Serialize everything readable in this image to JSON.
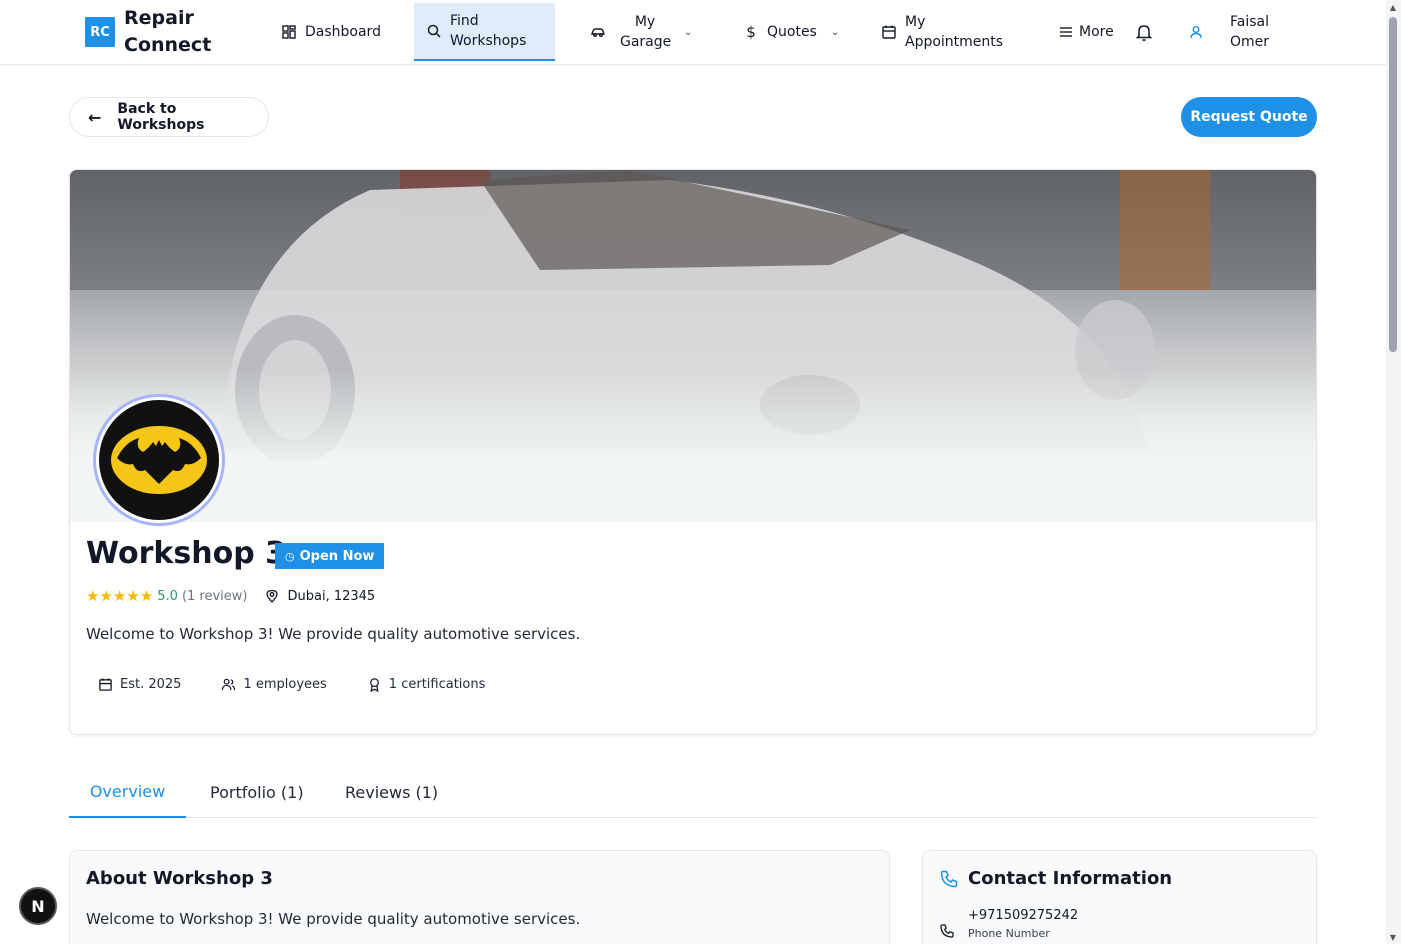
{
  "nav": {
    "logo_abbr": "RC",
    "logo_text": "Repair Connect",
    "items": [
      {
        "label": "Dashboard",
        "icon": "grid-icon"
      },
      {
        "label": "Find Workshops",
        "icon": "search-icon"
      },
      {
        "label": "My Garage",
        "icon": "car-icon"
      },
      {
        "label": "Quotes",
        "icon": "dollar-icon"
      },
      {
        "label": "My Appointments",
        "icon": "calendar-icon"
      },
      {
        "label": "More",
        "icon": "menu-icon"
      }
    ],
    "user_name": "Faisal Omer"
  },
  "actions": {
    "back_label": "Back to Workshops",
    "quote_label": "Request Quote"
  },
  "workshop": {
    "name": "Workshop 3",
    "status": "Open Now",
    "rating": 5.0,
    "rating_value": "5.0",
    "review_count": "(1 review)",
    "location": "Dubai, 12345",
    "description": "Welcome to Workshop 3! We provide quality automotive services.",
    "established": "Est. 2025",
    "employees": "1 employees",
    "certifications": "1 certifications"
  },
  "tabs": [
    {
      "label": "Overview",
      "active": true
    },
    {
      "label": "Portfolio (1)",
      "active": false
    },
    {
      "label": "Reviews (1)",
      "active": false
    }
  ],
  "about": {
    "title": "About Workshop 3",
    "text": "Welcome to Workshop 3! We provide quality automotive services."
  },
  "contact": {
    "title": "Contact Information",
    "phone": "+971509275242",
    "phone_label": "Phone Number"
  },
  "colors": {
    "accent": "#1e90e6",
    "star": "#f5b700",
    "rating": "#22a05a"
  },
  "dev_badge": "N"
}
